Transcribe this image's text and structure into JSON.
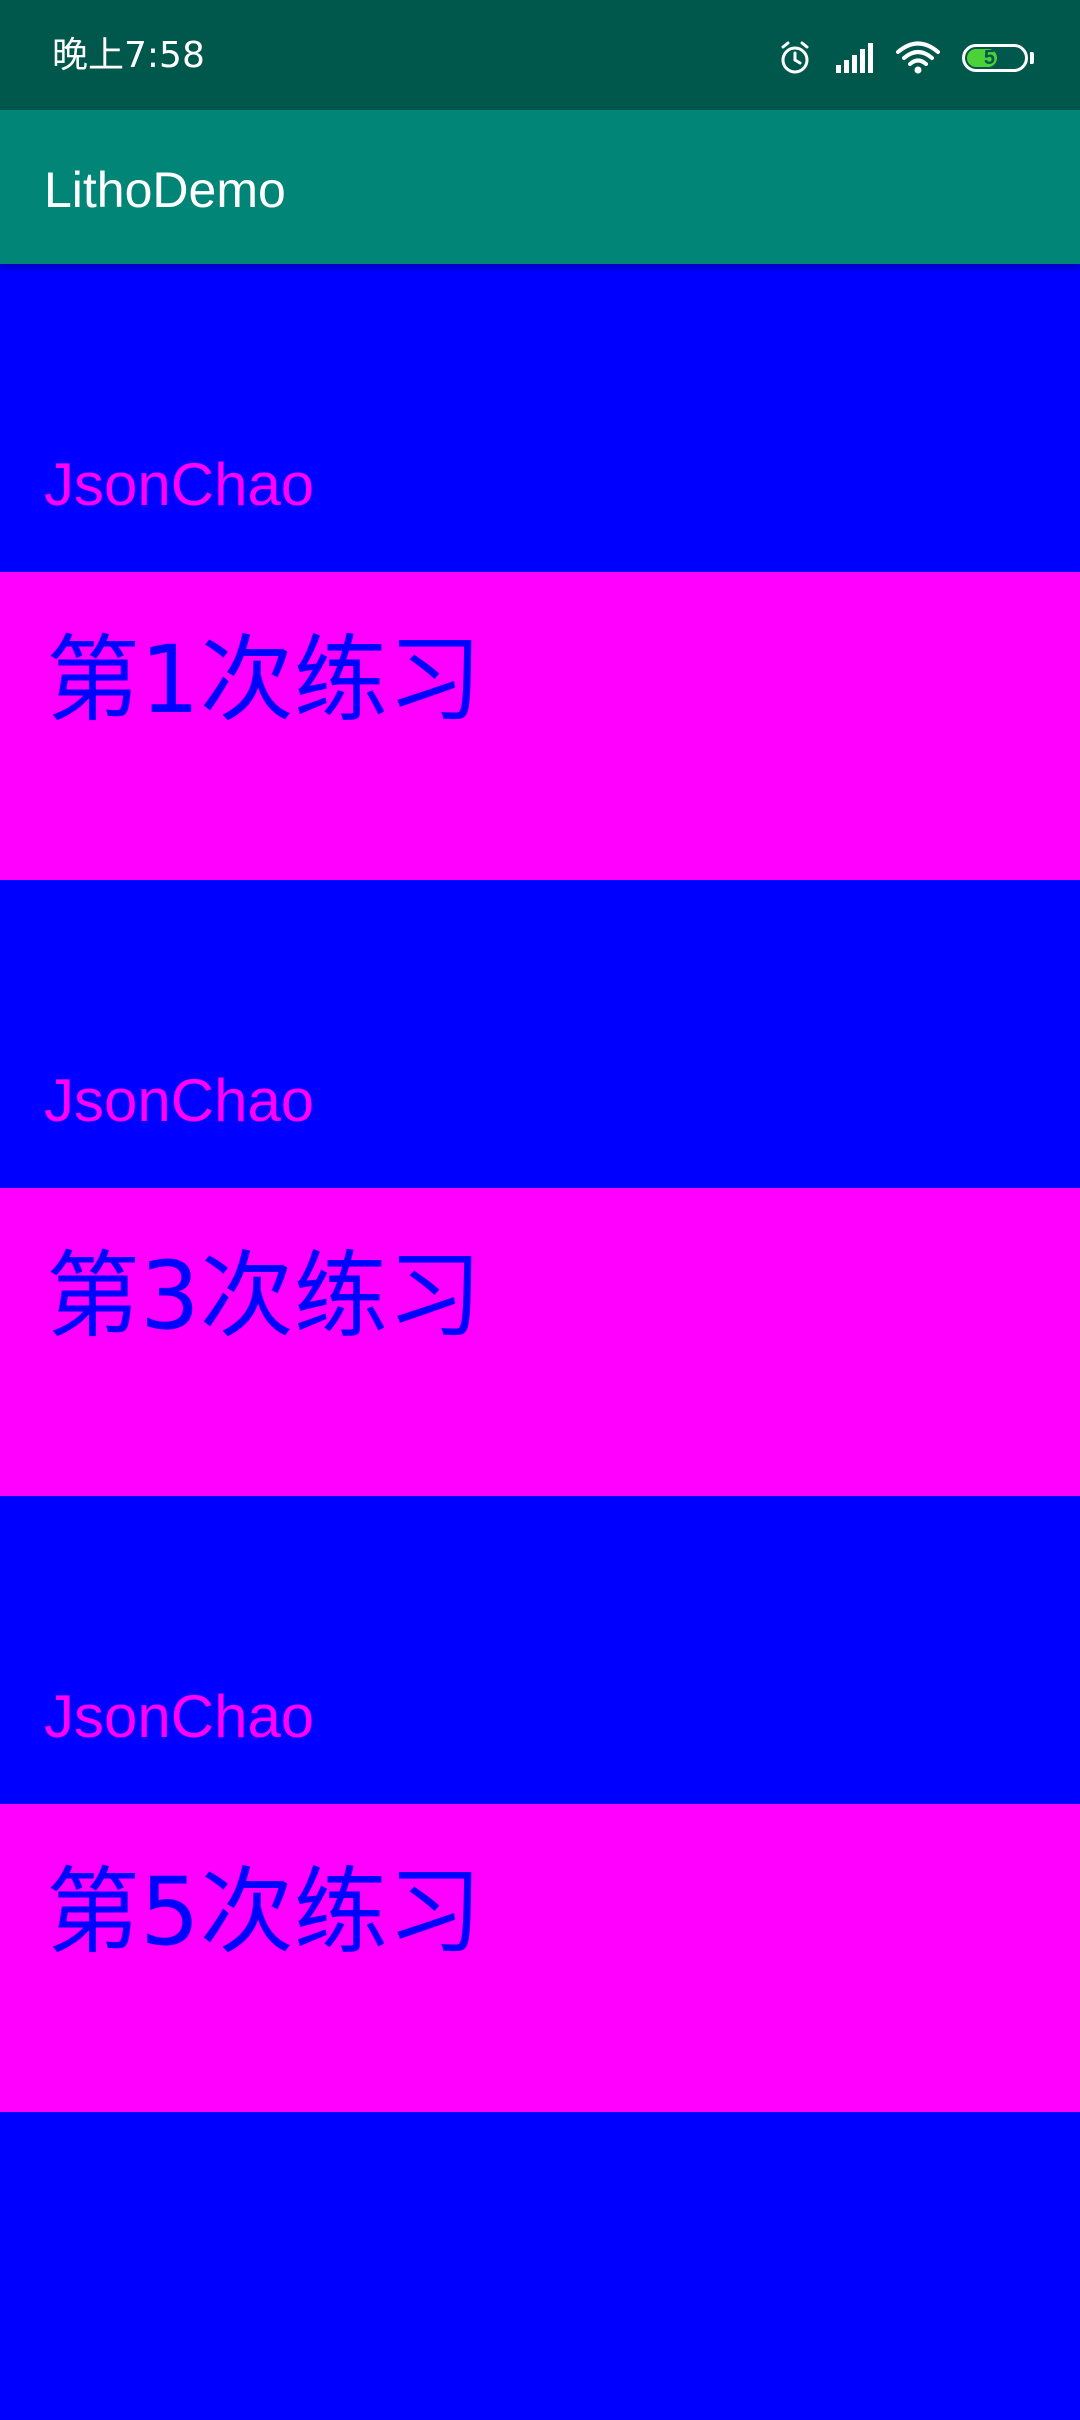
{
  "status_bar": {
    "time": "晚上7:58",
    "battery_level": "51",
    "icons": [
      "alarm-icon",
      "signal-icon",
      "wifi-icon",
      "battery-icon"
    ]
  },
  "app_bar": {
    "title": "LithoDemo"
  },
  "colors": {
    "status_bar": "#00574B",
    "app_bar": "#008577",
    "name_row_bg": "#0000FF",
    "name_row_text": "#FF00FF",
    "practice_row_bg": "#FF00FF",
    "practice_row_text": "#0000FF"
  },
  "list": {
    "items": [
      {
        "type": "name",
        "text": "JsonChao"
      },
      {
        "type": "practice",
        "text": "第1次练习"
      },
      {
        "type": "name",
        "text": "JsonChao"
      },
      {
        "type": "practice",
        "text": "第3次练习"
      },
      {
        "type": "name",
        "text": "JsonChao"
      },
      {
        "type": "practice",
        "text": "第5次练习"
      },
      {
        "type": "name",
        "text": ""
      }
    ]
  }
}
